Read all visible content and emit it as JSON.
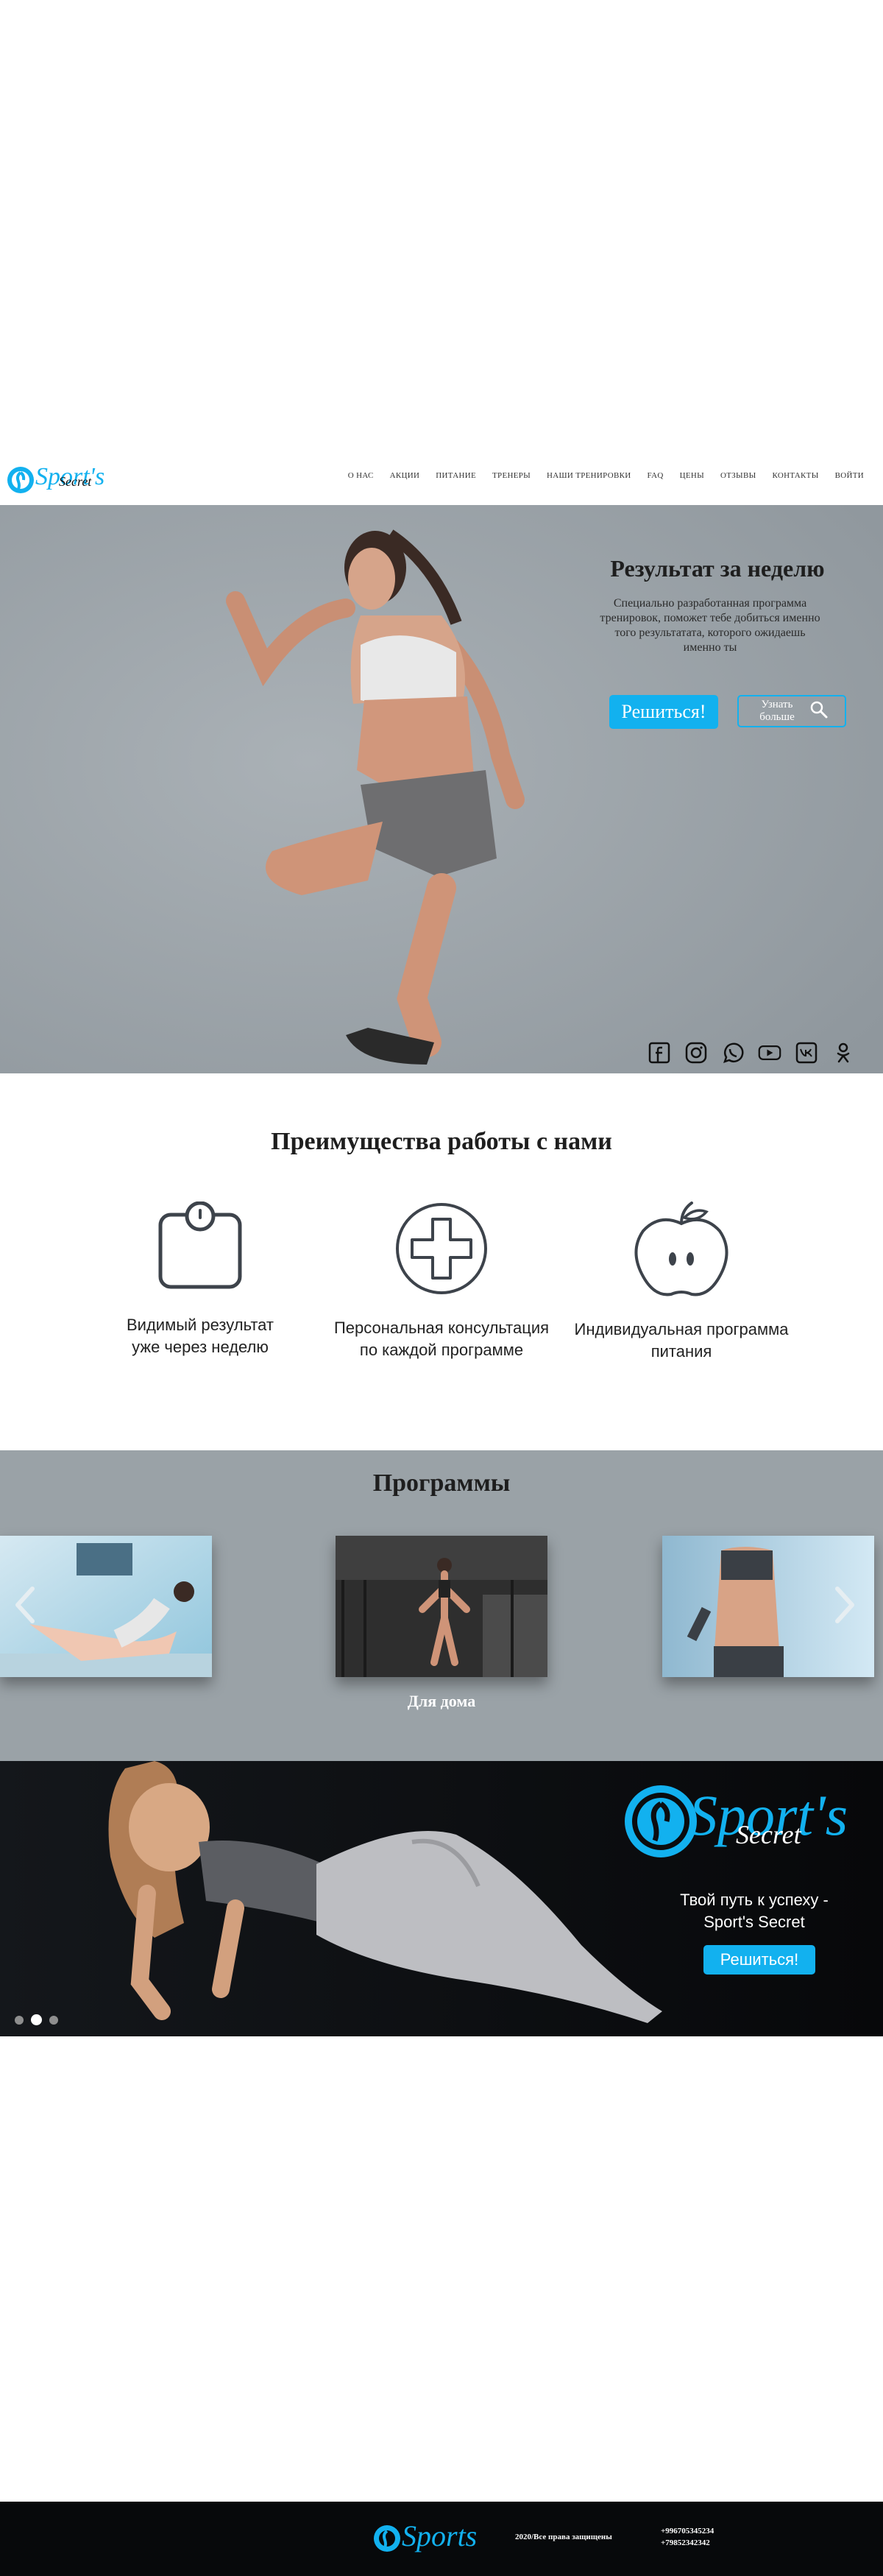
{
  "header": {
    "logo": {
      "word1": "Sport's",
      "word2": "Secret"
    },
    "nav": [
      "О НАС",
      "АКЦИИ",
      "ПИТАНИЕ",
      "ТРЕНЕРЫ",
      "НАШИ ТРЕНИРОВКИ",
      "FAQ",
      "ЦЕНЫ",
      "ОТЗЫВЫ",
      "КОНТАКТЫ",
      "ВОЙТИ"
    ]
  },
  "hero": {
    "title": "Результат за неделю",
    "text": "Специально разработанная программа тренировок, поможет тебе добиться именно того результатата, которого ожидаешь именно ты",
    "cta_label": "Решиться!",
    "more_label": "Узнать больше",
    "socials": [
      "facebook-icon",
      "instagram-icon",
      "whatsapp-icon",
      "youtube-icon",
      "vk-icon",
      "odnoklassniki-icon"
    ]
  },
  "advantages": {
    "title": "Преимущества работы с нами",
    "items": [
      {
        "icon": "scale-icon",
        "label": "Видимый результат уже через неделю"
      },
      {
        "icon": "medical-cross-icon",
        "label": "Персональная консультация по каждой программе"
      },
      {
        "icon": "apple-icon",
        "label": "Индивидуальная программа питания"
      }
    ]
  },
  "programs": {
    "title": "Программы",
    "active_caption": "Для дома"
  },
  "banner": {
    "logo": {
      "word1": "Sport's",
      "word2": "Secret"
    },
    "text": "Твой путь к успеху - Sport's Secret",
    "cta_label": "Решиться!",
    "slides": 3,
    "active_slide": 2
  },
  "footer": {
    "logo": {
      "word1": "Sports"
    },
    "copyright": "2020/Все права защищены",
    "phones": [
      "+996705345234",
      "+79852342342"
    ]
  },
  "colors": {
    "accent": "#12b1ef",
    "hero_bg": "#9aa2a8",
    "footer_bg": "#07090b"
  }
}
